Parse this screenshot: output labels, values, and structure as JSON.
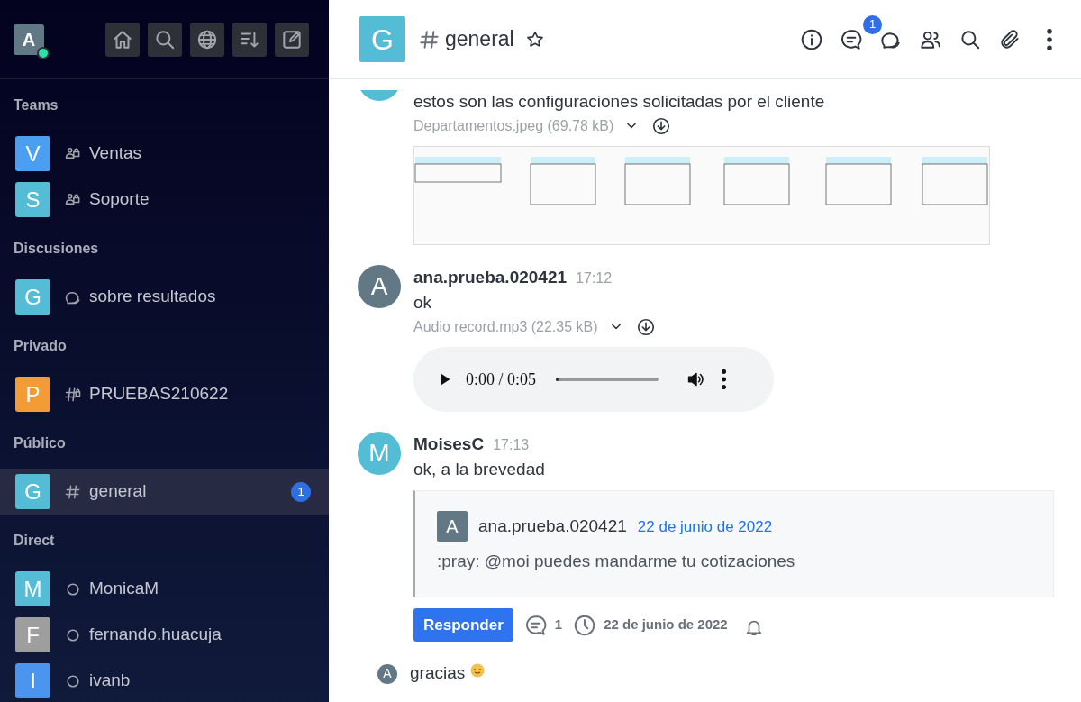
{
  "sidebar": {
    "user": {
      "avatar": "A",
      "color": "#627985",
      "online": true
    },
    "toolbar": [
      {
        "kind": "home"
      },
      {
        "kind": "search"
      },
      {
        "kind": "directory"
      },
      {
        "kind": "sort"
      },
      {
        "kind": "create"
      }
    ],
    "sections": [
      {
        "title": "Teams",
        "items": [
          {
            "avatar": "V",
            "color": "#4a9ff0",
            "kind": "team",
            "label": "Ventas",
            "selected": false
          },
          {
            "avatar": "S",
            "color": "#54bcd4",
            "kind": "team",
            "label": "Soporte",
            "selected": false
          }
        ]
      },
      {
        "title": "Discusiones",
        "items": [
          {
            "avatar": "G",
            "color": "#54bcd4",
            "kind": "discussion",
            "label": "sobre resultados",
            "selected": false
          }
        ]
      },
      {
        "title": "Privado",
        "items": [
          {
            "avatar": "P",
            "color": "#f39c36",
            "kind": "private",
            "label": "PRUEBAS210622",
            "selected": false
          }
        ]
      },
      {
        "title": "Público",
        "items": [
          {
            "avatar": "G",
            "color": "#54bcd4",
            "kind": "public",
            "label": "general",
            "selected": true,
            "badge": "1"
          }
        ]
      },
      {
        "title": "Direct",
        "items": [
          {
            "avatar": "M",
            "color": "#54bcd4",
            "kind": "direct",
            "label": "MonicaM",
            "selected": false
          },
          {
            "avatar": "F",
            "color": "#9e9e9e",
            "kind": "direct",
            "label": "fernando.huacuja",
            "selected": false
          },
          {
            "avatar": "I",
            "color": "#4b95ef",
            "kind": "direct",
            "label": "ivanb",
            "selected": false
          }
        ]
      }
    ]
  },
  "header": {
    "avatar": "G",
    "color": "#54bcd4",
    "title": "general",
    "favorite": false,
    "actions": [
      {
        "kind": "info"
      },
      {
        "kind": "threads",
        "badge": "1"
      },
      {
        "kind": "discussion"
      },
      {
        "kind": "members"
      },
      {
        "kind": "search"
      },
      {
        "kind": "files"
      },
      {
        "kind": "more"
      }
    ]
  },
  "messages": [
    {
      "kind": "cut",
      "color": "#54bcd4",
      "text": "estos son las configuraciones solicitadas por el cliente",
      "file": {
        "name": "Departamentos.jpeg (69.78 kB)"
      }
    },
    {
      "kind": "full",
      "avatar": "A",
      "color": "#627985",
      "user": "ana.prueba.020421",
      "time": "17:12",
      "text": "ok",
      "file": {
        "kind": "audio",
        "name": "Audio record.mp3 (22.35 kB)",
        "time": "0:00 / 0:05",
        "level": 0
      }
    },
    {
      "kind": "full",
      "avatar": "M",
      "color": "#54bcd4",
      "user": "MoisesC",
      "time": "17:13",
      "text": "ok, a la brevedad",
      "quote": {
        "avatar": "A",
        "color": "#627985",
        "user": "ana.prueba.020421",
        "date": "22 de junio de 2022",
        "text": ":pray: @moi puedes mandarme tu cotizaciones"
      },
      "thread": {
        "button": "Responder",
        "count": "1",
        "date": "22 de junio de 2022"
      }
    },
    {
      "kind": "compact",
      "avatar": "A",
      "color": "#627985",
      "text": "gracias",
      "emoji": true
    }
  ]
}
